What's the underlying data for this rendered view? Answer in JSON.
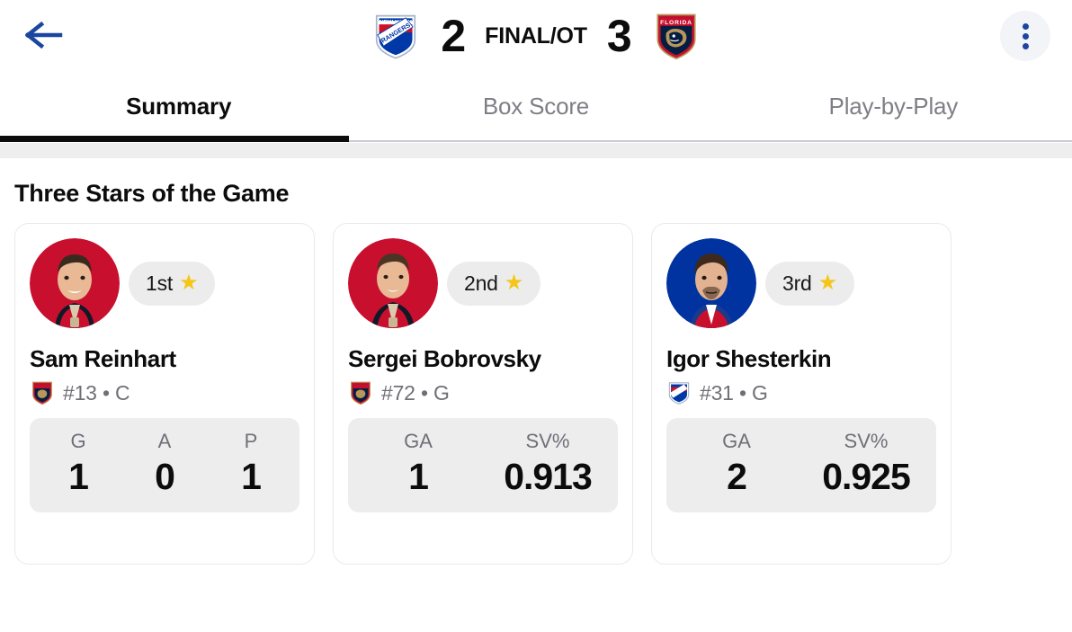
{
  "header": {
    "back_icon": "back-arrow-icon",
    "menu_icon": "kebab-menu-icon",
    "away_team": {
      "name": "New York Rangers",
      "abbrev": "NYR",
      "score": "2",
      "logo": "rangers-logo"
    },
    "home_team": {
      "name": "Florida Panthers",
      "abbrev": "FLA",
      "score": "3",
      "logo": "panthers-logo"
    },
    "status": "FINAL/OT",
    "accent_color": "#1b46a0"
  },
  "tabs": [
    {
      "label": "Summary",
      "active": true
    },
    {
      "label": "Box Score",
      "active": false
    },
    {
      "label": "Play-by-Play",
      "active": false
    }
  ],
  "section": {
    "title": "Three Stars of the Game"
  },
  "stars": [
    {
      "rank": "1st",
      "star_icon": "gold-star-icon",
      "name": "Sam Reinhart",
      "team_logo": "panthers-logo",
      "meta": "#13 • C",
      "avatar_bg": "#c8102e",
      "stats": [
        {
          "label": "G",
          "value": "1"
        },
        {
          "label": "A",
          "value": "0"
        },
        {
          "label": "P",
          "value": "1"
        }
      ]
    },
    {
      "rank": "2nd",
      "star_icon": "gold-star-icon",
      "name": "Sergei Bobrovsky",
      "team_logo": "panthers-logo",
      "meta": "#72 • G",
      "avatar_bg": "#c8102e",
      "stats": [
        {
          "label": "GA",
          "value": "1"
        },
        {
          "label": "SV%",
          "value": "0.913"
        }
      ]
    },
    {
      "rank": "3rd",
      "star_icon": "gold-star-icon",
      "name": "Igor Shesterkin",
      "team_logo": "rangers-logo",
      "meta": "#31 • G",
      "avatar_bg": "#0033a0",
      "stats": [
        {
          "label": "GA",
          "value": "2"
        },
        {
          "label": "SV%",
          "value": "0.925"
        }
      ]
    }
  ]
}
